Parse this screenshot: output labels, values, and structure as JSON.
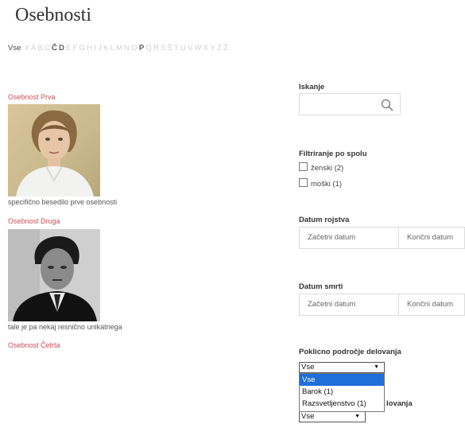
{
  "page": {
    "title": "Osebnosti"
  },
  "alphabet": {
    "first": "Vse",
    "letters": [
      "#",
      "A",
      "B",
      "C",
      "Č",
      "D",
      "E",
      "F",
      "G",
      "H",
      "I",
      "J",
      "K",
      "L",
      "M",
      "N",
      "O",
      "P",
      "Q",
      "R",
      "S",
      "Š",
      "T",
      "U",
      "V",
      "W",
      "X",
      "Y",
      "Z",
      "Ž"
    ],
    "active": [
      "Č",
      "D",
      "P"
    ]
  },
  "people": [
    {
      "name": "Osebnost Prva",
      "desc": "specifično besedilo prve osebnosti",
      "photo_icon": "woman-portrait-painting"
    },
    {
      "name": "Osebnost Druga",
      "desc": "tale je pa nekaj resnično unikatnega",
      "photo_icon": "man-portrait-photo"
    },
    {
      "name": "Osebnost Četrta"
    }
  ],
  "sidebar": {
    "search": {
      "label": "Iskanje",
      "icon": "search-icon"
    },
    "gender": {
      "label": "Filtriranje po spolu",
      "options": [
        "ženski (2)",
        "moški (1)"
      ]
    },
    "birth": {
      "label": "Datum rojstva",
      "start": "Začetni datum",
      "end": "Končni datum"
    },
    "death": {
      "label": "Datum smrti",
      "start": "Začetni datum",
      "end": "Končni datum"
    },
    "field": {
      "label": "Poklicno področje delovanja",
      "selected": "Vse",
      "options": [
        "Vse",
        "Barok (1)",
        "Razsvetljenstvo (1)"
      ]
    },
    "field2": {
      "label_tail": "lovanja",
      "selected": "Vse"
    }
  },
  "colors": {
    "link": "#c9505a",
    "highlight": "#1e6fd9"
  }
}
